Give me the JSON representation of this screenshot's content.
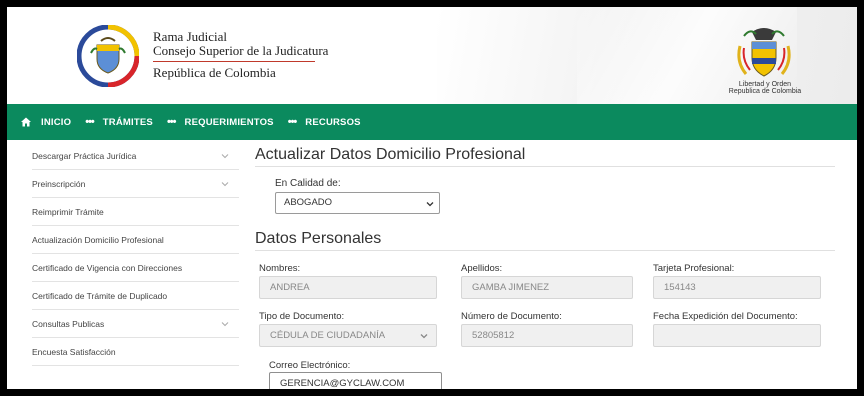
{
  "header": {
    "brand_line1": "Rama Judicial",
    "brand_line2": "Consejo Superior de la Judicatura",
    "brand_line3": "República de Colombia",
    "motto_line1": "Libertad y Orden",
    "motto_line2": "Republica de Colombia"
  },
  "nav": {
    "items": [
      {
        "label": "INICIO"
      },
      {
        "label": "TRÁMITES"
      },
      {
        "label": "REQUERIMIENTOS"
      },
      {
        "label": "RECURSOS"
      }
    ],
    "color": "#0b8a5e"
  },
  "sidebar": {
    "items": [
      {
        "label": "Descargar Práctica Jurídica",
        "has_chevron": true
      },
      {
        "label": "Preinscripción",
        "has_chevron": true
      },
      {
        "label": "Reimprimir Trámite",
        "has_chevron": false
      },
      {
        "label": "Actualización Domicilio Profesional",
        "has_chevron": false
      },
      {
        "label": "Certificado de Vigencia con Direcciones",
        "has_chevron": false
      },
      {
        "label": "Certificado de Trámite de Duplicado",
        "has_chevron": false
      },
      {
        "label": "Consultas Publicas",
        "has_chevron": true
      },
      {
        "label": "Encuesta Satisfacción",
        "has_chevron": false
      }
    ]
  },
  "main": {
    "title": "Actualizar Datos Domicilio Profesional",
    "role_label": "En Calidad de:",
    "role_value": "ABOGADO",
    "section_title": "Datos Personales",
    "fields": {
      "nombres": {
        "label": "Nombres:",
        "value": "ANDREA"
      },
      "apellidos": {
        "label": "Apellidos:",
        "value": "GAMBA JIMENEZ"
      },
      "tarjeta": {
        "label": "Tarjeta Profesional:",
        "value": "154143"
      },
      "tipo_doc": {
        "label": "Tipo de Documento:",
        "value": "CÉDULA DE CIUDADANÍA"
      },
      "num_doc": {
        "label": "Número de Documento:",
        "value": "52805812"
      },
      "fecha_exp": {
        "label": "Fecha Expedición del Documento:",
        "value": ""
      },
      "correo": {
        "label": "Correo Electrónico:",
        "value": "GERENCIA@GYCLAW.COM"
      }
    }
  }
}
